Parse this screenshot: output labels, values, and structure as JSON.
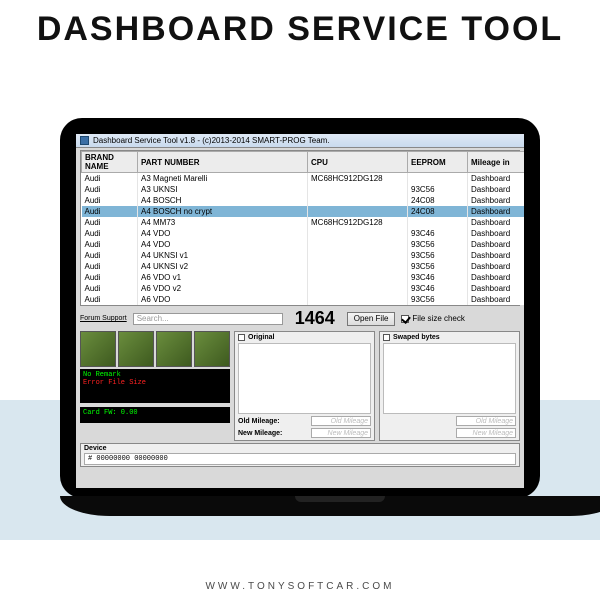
{
  "hero_title": "DASHBOARD SERVICE TOOL",
  "footer_url": "WWW.TONYSOFTCAR.COM",
  "window_title": "Dashboard Service Tool v1.8 - (c)2013-2014 SMART-PROG Team.",
  "columns": {
    "brand": "BRAND NAME",
    "part": "PART NUMBER",
    "cpu": "CPU",
    "eeprom": "EEPROM",
    "mileage": "Mileage in"
  },
  "rows": [
    {
      "brand": "Audi",
      "part": "A3 Magneti Marelli",
      "cpu": "MC68HC912DG128",
      "eeprom": "",
      "mileage": "Dashboard"
    },
    {
      "brand": "Audi",
      "part": "A3 UKNSI",
      "cpu": "",
      "eeprom": "93C56",
      "mileage": "Dashboard"
    },
    {
      "brand": "Audi",
      "part": "A4 BOSCH",
      "cpu": "",
      "eeprom": "24C08",
      "mileage": "Dashboard"
    },
    {
      "brand": "Audi",
      "part": "A4 BOSCH no crypt",
      "cpu": "",
      "eeprom": "24C08",
      "mileage": "Dashboard"
    },
    {
      "brand": "Audi",
      "part": "A4 MM73",
      "cpu": "MC68HC912DG128",
      "eeprom": "",
      "mileage": "Dashboard"
    },
    {
      "brand": "Audi",
      "part": "A4 VDO",
      "cpu": "",
      "eeprom": "93C46",
      "mileage": "Dashboard"
    },
    {
      "brand": "Audi",
      "part": "A4 VDO",
      "cpu": "",
      "eeprom": "93C56",
      "mileage": "Dashboard"
    },
    {
      "brand": "Audi",
      "part": "A4 UKNSI v1",
      "cpu": "",
      "eeprom": "93C56",
      "mileage": "Dashboard"
    },
    {
      "brand": "Audi",
      "part": "A4 UKNSI v2",
      "cpu": "",
      "eeprom": "93C56",
      "mileage": "Dashboard"
    },
    {
      "brand": "Audi",
      "part": "A6 VDO v1",
      "cpu": "",
      "eeprom": "93C46",
      "mileage": "Dashboard"
    },
    {
      "brand": "Audi",
      "part": "A6 VDO v2",
      "cpu": "",
      "eeprom": "93C46",
      "mileage": "Dashboard"
    },
    {
      "brand": "Audi",
      "part": "A6 VDO",
      "cpu": "",
      "eeprom": "93C56",
      "mileage": "Dashboard"
    }
  ],
  "selected_row_index": 3,
  "forum_link": "Forum Support",
  "search_placeholder": "Search...",
  "big_number": "1464",
  "open_file_btn": "Open File",
  "file_size_check": "File size check",
  "console": {
    "line1": "No Remark",
    "line2": "Error File Size"
  },
  "console2": "Card FW: 0.00",
  "panel_original": "Original",
  "panel_swapped": "Swaped bytes",
  "old_mileage_label": "Old Mileage:",
  "new_mileage_label": "New Mileage:",
  "old_mileage_placeholder": "Old Mileage",
  "new_mileage_placeholder": "New Mileage",
  "device_label": "Device",
  "device_value": "# 00000000 00000000"
}
